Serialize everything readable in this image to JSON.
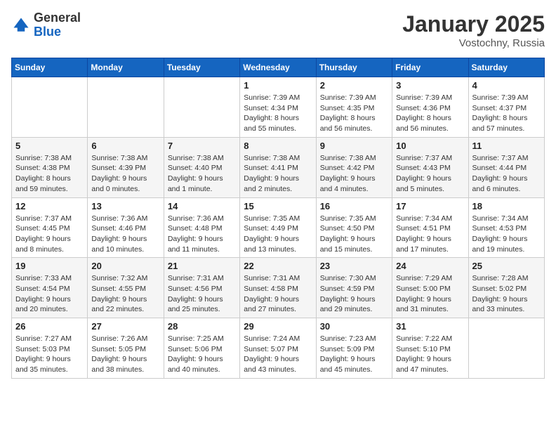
{
  "header": {
    "logo_general": "General",
    "logo_blue": "Blue",
    "month_year": "January 2025",
    "location": "Vostochny, Russia"
  },
  "weekdays": [
    "Sunday",
    "Monday",
    "Tuesday",
    "Wednesday",
    "Thursday",
    "Friday",
    "Saturday"
  ],
  "weeks": [
    [
      {
        "day": "",
        "sunrise": "",
        "sunset": "",
        "daylight": ""
      },
      {
        "day": "",
        "sunrise": "",
        "sunset": "",
        "daylight": ""
      },
      {
        "day": "",
        "sunrise": "",
        "sunset": "",
        "daylight": ""
      },
      {
        "day": "1",
        "sunrise": "Sunrise: 7:39 AM",
        "sunset": "Sunset: 4:34 PM",
        "daylight": "Daylight: 8 hours and 55 minutes."
      },
      {
        "day": "2",
        "sunrise": "Sunrise: 7:39 AM",
        "sunset": "Sunset: 4:35 PM",
        "daylight": "Daylight: 8 hours and 56 minutes."
      },
      {
        "day": "3",
        "sunrise": "Sunrise: 7:39 AM",
        "sunset": "Sunset: 4:36 PM",
        "daylight": "Daylight: 8 hours and 56 minutes."
      },
      {
        "day": "4",
        "sunrise": "Sunrise: 7:39 AM",
        "sunset": "Sunset: 4:37 PM",
        "daylight": "Daylight: 8 hours and 57 minutes."
      }
    ],
    [
      {
        "day": "5",
        "sunrise": "Sunrise: 7:38 AM",
        "sunset": "Sunset: 4:38 PM",
        "daylight": "Daylight: 8 hours and 59 minutes."
      },
      {
        "day": "6",
        "sunrise": "Sunrise: 7:38 AM",
        "sunset": "Sunset: 4:39 PM",
        "daylight": "Daylight: 9 hours and 0 minutes."
      },
      {
        "day": "7",
        "sunrise": "Sunrise: 7:38 AM",
        "sunset": "Sunset: 4:40 PM",
        "daylight": "Daylight: 9 hours and 1 minute."
      },
      {
        "day": "8",
        "sunrise": "Sunrise: 7:38 AM",
        "sunset": "Sunset: 4:41 PM",
        "daylight": "Daylight: 9 hours and 2 minutes."
      },
      {
        "day": "9",
        "sunrise": "Sunrise: 7:38 AM",
        "sunset": "Sunset: 4:42 PM",
        "daylight": "Daylight: 9 hours and 4 minutes."
      },
      {
        "day": "10",
        "sunrise": "Sunrise: 7:37 AM",
        "sunset": "Sunset: 4:43 PM",
        "daylight": "Daylight: 9 hours and 5 minutes."
      },
      {
        "day": "11",
        "sunrise": "Sunrise: 7:37 AM",
        "sunset": "Sunset: 4:44 PM",
        "daylight": "Daylight: 9 hours and 6 minutes."
      }
    ],
    [
      {
        "day": "12",
        "sunrise": "Sunrise: 7:37 AM",
        "sunset": "Sunset: 4:45 PM",
        "daylight": "Daylight: 9 hours and 8 minutes."
      },
      {
        "day": "13",
        "sunrise": "Sunrise: 7:36 AM",
        "sunset": "Sunset: 4:46 PM",
        "daylight": "Daylight: 9 hours and 10 minutes."
      },
      {
        "day": "14",
        "sunrise": "Sunrise: 7:36 AM",
        "sunset": "Sunset: 4:48 PM",
        "daylight": "Daylight: 9 hours and 11 minutes."
      },
      {
        "day": "15",
        "sunrise": "Sunrise: 7:35 AM",
        "sunset": "Sunset: 4:49 PM",
        "daylight": "Daylight: 9 hours and 13 minutes."
      },
      {
        "day": "16",
        "sunrise": "Sunrise: 7:35 AM",
        "sunset": "Sunset: 4:50 PM",
        "daylight": "Daylight: 9 hours and 15 minutes."
      },
      {
        "day": "17",
        "sunrise": "Sunrise: 7:34 AM",
        "sunset": "Sunset: 4:51 PM",
        "daylight": "Daylight: 9 hours and 17 minutes."
      },
      {
        "day": "18",
        "sunrise": "Sunrise: 7:34 AM",
        "sunset": "Sunset: 4:53 PM",
        "daylight": "Daylight: 9 hours and 19 minutes."
      }
    ],
    [
      {
        "day": "19",
        "sunrise": "Sunrise: 7:33 AM",
        "sunset": "Sunset: 4:54 PM",
        "daylight": "Daylight: 9 hours and 20 minutes."
      },
      {
        "day": "20",
        "sunrise": "Sunrise: 7:32 AM",
        "sunset": "Sunset: 4:55 PM",
        "daylight": "Daylight: 9 hours and 22 minutes."
      },
      {
        "day": "21",
        "sunrise": "Sunrise: 7:31 AM",
        "sunset": "Sunset: 4:56 PM",
        "daylight": "Daylight: 9 hours and 25 minutes."
      },
      {
        "day": "22",
        "sunrise": "Sunrise: 7:31 AM",
        "sunset": "Sunset: 4:58 PM",
        "daylight": "Daylight: 9 hours and 27 minutes."
      },
      {
        "day": "23",
        "sunrise": "Sunrise: 7:30 AM",
        "sunset": "Sunset: 4:59 PM",
        "daylight": "Daylight: 9 hours and 29 minutes."
      },
      {
        "day": "24",
        "sunrise": "Sunrise: 7:29 AM",
        "sunset": "Sunset: 5:00 PM",
        "daylight": "Daylight: 9 hours and 31 minutes."
      },
      {
        "day": "25",
        "sunrise": "Sunrise: 7:28 AM",
        "sunset": "Sunset: 5:02 PM",
        "daylight": "Daylight: 9 hours and 33 minutes."
      }
    ],
    [
      {
        "day": "26",
        "sunrise": "Sunrise: 7:27 AM",
        "sunset": "Sunset: 5:03 PM",
        "daylight": "Daylight: 9 hours and 35 minutes."
      },
      {
        "day": "27",
        "sunrise": "Sunrise: 7:26 AM",
        "sunset": "Sunset: 5:05 PM",
        "daylight": "Daylight: 9 hours and 38 minutes."
      },
      {
        "day": "28",
        "sunrise": "Sunrise: 7:25 AM",
        "sunset": "Sunset: 5:06 PM",
        "daylight": "Daylight: 9 hours and 40 minutes."
      },
      {
        "day": "29",
        "sunrise": "Sunrise: 7:24 AM",
        "sunset": "Sunset: 5:07 PM",
        "daylight": "Daylight: 9 hours and 43 minutes."
      },
      {
        "day": "30",
        "sunrise": "Sunrise: 7:23 AM",
        "sunset": "Sunset: 5:09 PM",
        "daylight": "Daylight: 9 hours and 45 minutes."
      },
      {
        "day": "31",
        "sunrise": "Sunrise: 7:22 AM",
        "sunset": "Sunset: 5:10 PM",
        "daylight": "Daylight: 9 hours and 47 minutes."
      },
      {
        "day": "",
        "sunrise": "",
        "sunset": "",
        "daylight": ""
      }
    ]
  ]
}
